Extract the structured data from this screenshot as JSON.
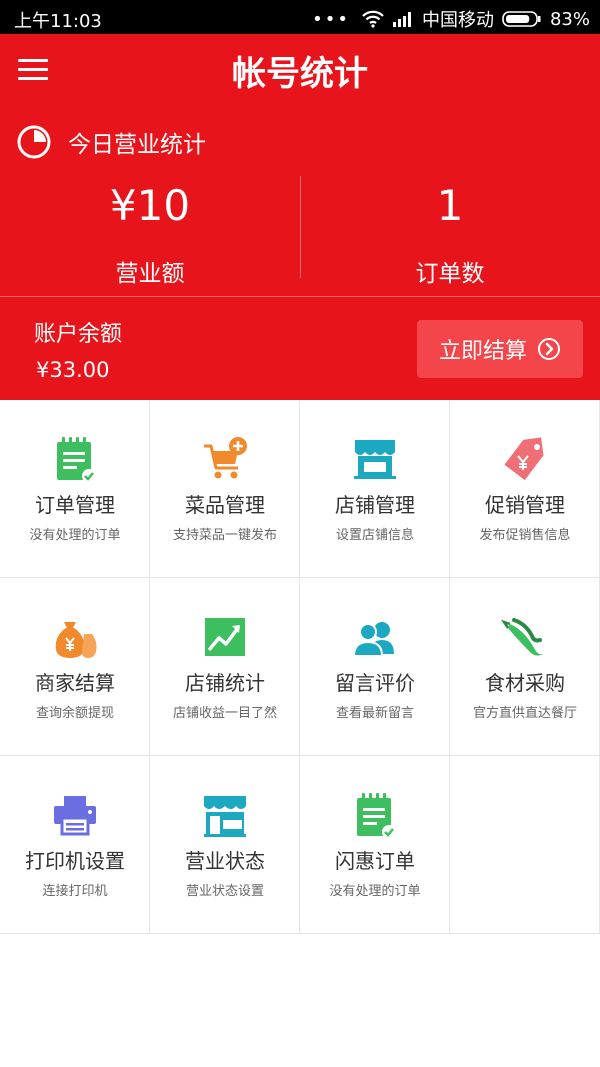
{
  "status_bar": {
    "time": "上午11:03",
    "carrier": "中国移动",
    "battery": "83%",
    "battery_level": 0.83
  },
  "header": {
    "title": "帐号统计"
  },
  "today": {
    "label": "今日营业统计"
  },
  "stats": [
    {
      "value": "¥10",
      "label": "营业额"
    },
    {
      "value": "1",
      "label": "订单数"
    }
  ],
  "balance": {
    "label": "账户余额",
    "value": "¥33.00",
    "button_label": "立即结算"
  },
  "grid": [
    {
      "name": "订单管理",
      "desc": "没有处理的订单",
      "icon": "order-clipboard-icon",
      "color": "#3dbf60"
    },
    {
      "name": "菜品管理",
      "desc": "支持菜品一键发布",
      "icon": "cart-add-icon",
      "color": "#f08a2d"
    },
    {
      "name": "店铺管理",
      "desc": "设置店铺信息",
      "icon": "storefront-icon",
      "color": "#1ba8c0"
    },
    {
      "name": "促销管理",
      "desc": "发布促销售信息",
      "icon": "price-tag-icon",
      "color": "#f06f77"
    },
    {
      "name": "商家结算",
      "desc": "查询余额提现",
      "icon": "money-bag-icon",
      "color": "#f08a2d"
    },
    {
      "name": "店铺统计",
      "desc": "店铺收益一目了然",
      "icon": "trend-chart-icon",
      "color": "#3dbf60"
    },
    {
      "name": "留言评价",
      "desc": "查看最新留言",
      "icon": "users-icon",
      "color": "#1ba8c0"
    },
    {
      "name": "食材采购",
      "desc": "官方直供直达餐厅",
      "icon": "chili-pepper-icon",
      "color": "#3dbf60"
    },
    {
      "name": "打印机设置",
      "desc": "连接打印机",
      "icon": "printer-icon",
      "color": "#6a6ee0"
    },
    {
      "name": "营业状态",
      "desc": "营业状态设置",
      "icon": "open-shop-icon",
      "color": "#1ba8c0"
    },
    {
      "name": "闪惠订单",
      "desc": "没有处理的订单",
      "icon": "order-clipboard-icon",
      "color": "#3dbf60"
    }
  ]
}
